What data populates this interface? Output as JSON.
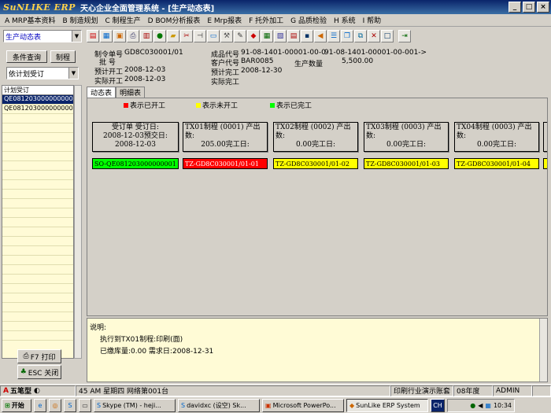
{
  "window": {
    "logo": "SuNLIKE ERP",
    "title": "天心企业全面管理系统 - [生产动态表]",
    "min": "_",
    "max": "□",
    "close": "×"
  },
  "menu": [
    "A MRP基本资料",
    "B 制造规划",
    "C 制程生产",
    "D BOM分析报表",
    "E Mrp报表",
    "F 托外加工",
    "G 品质检验",
    "H 系统",
    "I 帮助"
  ],
  "toolbar": {
    "combo_value": "生产动态表"
  },
  "left": {
    "query_button": "条件查询",
    "process_button": "制程",
    "combo_value": "依计划受订",
    "list_header": "计划受订",
    "list_items": [
      "QE081203000000000",
      "QE081203000000000"
    ],
    "print_button": "F7 打印",
    "close_button": "ESC 关闭"
  },
  "info": {
    "order_no_label": "制令单号",
    "order_no": "GD8C030001/01",
    "batch_label": "批    号",
    "plan_start_label": "预计开工",
    "plan_start": "2008-12-03",
    "actual_start_label": "实际开工",
    "actual_start": "2008-12-03",
    "product_code_label": "成品代号",
    "product_code": "91-08-1401-00001-00-0",
    "product_code_extra": "91-08-1401-00001-00-001->",
    "customer_label": "客户代号",
    "customer": "BAR0085",
    "qty_label": "生产数量",
    "qty": "5,500.00",
    "plan_finish_label": "预计完工",
    "plan_finish": "2008-12-30",
    "actual_finish_label": "实际完工"
  },
  "tabs": [
    "动态表",
    "明细表"
  ],
  "legend": [
    {
      "label": "表示已开工",
      "color": "#ff0000"
    },
    {
      "label": "表示未开工",
      "color": "#ffff00"
    },
    {
      "label": "表示已完工",
      "color": "#00ff00"
    }
  ],
  "columns": [
    {
      "head1": "受订单    受订日:",
      "head2": "2008-12-03预交日:",
      "head3": "2008-12-03",
      "node": "SO-QE081203000000001",
      "color": "#00ff00"
    },
    {
      "head1": "TX01制程 (0001) 产出数:",
      "head2": "205.00完工日:",
      "head3": "",
      "node": "TZ-GD8C030001/01-01",
      "color": "#ff0000",
      "text_color": "#ffffff"
    },
    {
      "head1": "TX02制程 (0002) 产出数:",
      "head2": "0.00完工日:",
      "head3": "",
      "node": "TZ-GD8C030001/01-02",
      "color": "#ffff00"
    },
    {
      "head1": "TX03制程 (0003) 产出数:",
      "head2": "0.00完工日:",
      "head3": "",
      "node": "TZ-GD8C030001/01-03",
      "color": "#ffff00"
    },
    {
      "head1": "TX04制程 (0003) 产出数:",
      "head2": "0.00完工日:",
      "head3": "",
      "node": "TZ-GD8C030001/01-04",
      "color": "#ffff00"
    }
  ],
  "description": {
    "title": "说明:",
    "line1": "执行到TX01制程:印刷(面)",
    "line2": "已缴库量:0.00  需求日:2008-12-31"
  },
  "status": {
    "ime": "五笔型",
    "time": "45 AM  星期四  网络第001台",
    "company": "印刷行业演示账套",
    "year": "08年度",
    "user": "ADMIN"
  },
  "taskbar": {
    "start": "开始",
    "tasks": [
      "Skype (TM) - heji...",
      "davidxc (设空) Sk...",
      "Microsoft PowerPo...",
      "SunLike ERP System"
    ],
    "lang": "CH",
    "clock": "10:34"
  }
}
